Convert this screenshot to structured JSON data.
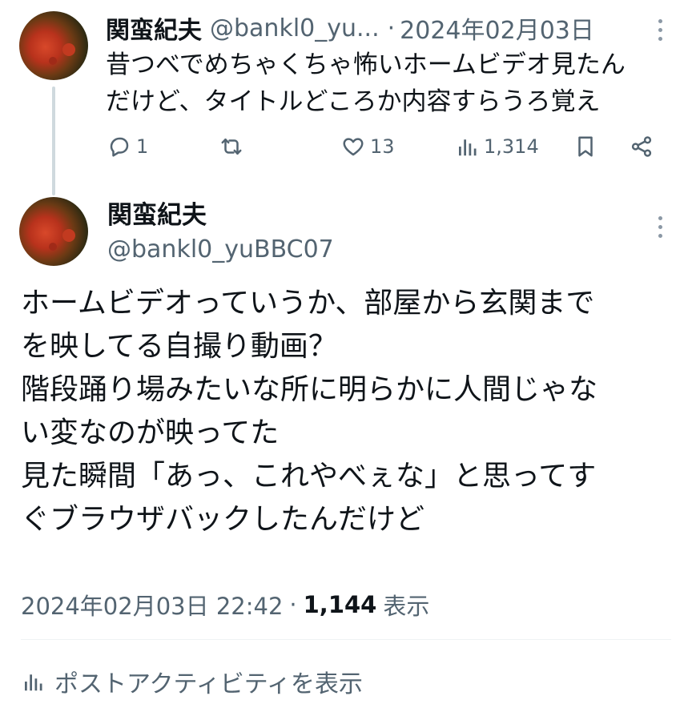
{
  "tweet1": {
    "display_name": "関蛮紀夫",
    "handle": "@bankl0_yu...",
    "separator": "·",
    "date": "2024年02月03日",
    "text_lines": [
      "昔つべでめちゃくちゃ怖いホームビデオ見たん",
      "だけど、タイトルどころか内容すらうろ覚え"
    ],
    "reply_count": "1",
    "retweet_count": "",
    "like_count": "13",
    "view_count": "1,314"
  },
  "tweet2": {
    "display_name": "関蛮紀夫",
    "handle": "@bankl0_yuBBC07",
    "body_lines": [
      "ホームビデオっていうか、部屋から玄関まで",
      "を映してる自撮り動画？",
      "階段踊り場みたいな所に明らかに人間じゃな",
      "い変なのが映ってた",
      "見た瞬間「あっ、これやべぇな」と思ってす",
      "ぐブラウザバックしたんだけど"
    ],
    "timestamp": "2024年02月03日 22:42",
    "separator": "·",
    "views_count": "1,144",
    "views_label": "表示"
  },
  "activity_label": "ポストアクティビティを表示",
  "icons": {
    "reply": "reply-icon",
    "retweet": "retweet-icon",
    "like": "heart-icon",
    "views": "analytics-icon",
    "bookmark": "bookmark-icon",
    "share": "share-icon",
    "more": "more-vertical-icon"
  },
  "colors": {
    "text": "#0f1419",
    "secondary": "#536471",
    "thread_line": "#cfd9de",
    "divider": "#eff3f4"
  }
}
